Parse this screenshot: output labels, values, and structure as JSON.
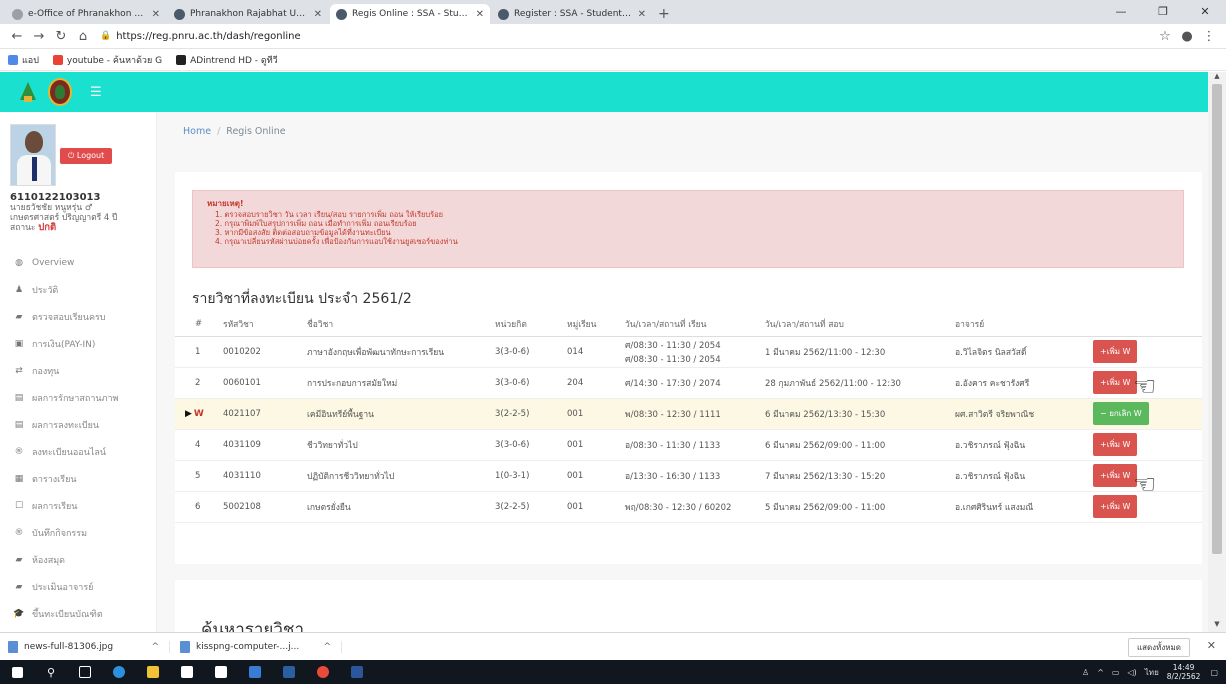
{
  "browser": {
    "tabs": [
      {
        "title": "e-Office of Phranakhon Rajabhat",
        "icon_color": "#9aa0a6"
      },
      {
        "title": "Phranakhon Rajabhat University",
        "icon_color": "#4a5a6a"
      },
      {
        "title": "Regis Online : SSA - Student Sup",
        "icon_color": "#4a5a6a"
      },
      {
        "title": "Register : SSA - Student Support",
        "icon_color": "#4a5a6a"
      }
    ],
    "new_tab": "+",
    "url": "https://reg.pnru.ac.th/dash/regonline",
    "bookmarks": [
      {
        "label": "แอป",
        "icon_color": "#4f8ae8"
      },
      {
        "label": "youtube - ค้นหาด้วย G",
        "icon_color": "#ea4335"
      },
      {
        "label": "ADintrend HD - ดูทีวี",
        "icon_color": "#222222"
      }
    ]
  },
  "sidebar": {
    "logout_label": "Logout",
    "student_id": "6110122103013",
    "student_name": "นายธวัชชัย หนูหรุ่น ♂",
    "program": "เกษตรศาสตร์ ปริญญาตรี 4 ปี",
    "status_label": "สถานะ",
    "status_value": "ปกติ",
    "nav": [
      {
        "label": "Overview",
        "icon": "dashboard-icon",
        "glyph": "◍"
      },
      {
        "label": "ประวัติ",
        "icon": "user-icon",
        "glyph": "♟"
      },
      {
        "label": "ตรวจสอบเรียนครบ",
        "icon": "book-icon",
        "glyph": "▰"
      },
      {
        "label": "การเงิน(PAY-IN)",
        "icon": "money-icon",
        "glyph": "▣"
      },
      {
        "label": "กองทุน",
        "icon": "fund-icon",
        "glyph": "⇄"
      },
      {
        "label": "ผลการรักษาสถานภาพ",
        "icon": "document-icon",
        "glyph": "▤"
      },
      {
        "label": "ผลการลงทะเบียน",
        "icon": "register-icon",
        "glyph": "▤"
      },
      {
        "label": "ลงทะเบียนออนไลน์",
        "icon": "online-icon",
        "glyph": "®"
      },
      {
        "label": "ตารางเรียน",
        "icon": "calendar-icon",
        "glyph": "▦"
      },
      {
        "label": "ผลการเรียน",
        "icon": "grade-icon",
        "glyph": "☐"
      },
      {
        "label": "บันทึกกิจกรรม",
        "icon": "activity-icon",
        "glyph": "®"
      },
      {
        "label": "ห้องสมุด",
        "icon": "library-icon",
        "glyph": "▰"
      },
      {
        "label": "ประเมินอาจารย์",
        "icon": "evaluate-icon",
        "glyph": "▰"
      },
      {
        "label": "ขึ้นทะเบียนบัณฑิต",
        "icon": "graduate-icon",
        "glyph": "🎓"
      }
    ]
  },
  "main": {
    "breadcrumb": {
      "home": "Home",
      "current": "Regis Online"
    },
    "notice": {
      "title": "หมายเหตุ!",
      "lines": [
        "1. ตรวจสอบรายวิชา วัน เวลา เรียน/สอบ รายการเพิ่ม ถอน ให้เรียบร้อย",
        "2. กรุณาพิมพ์ใบสรุปการเพิ่ม ถอน เมื่อทำการเพิ่ม ถอนเรียบร้อย",
        "3. หากมีข้อสงสัย ติดต่อสอบถามข้อมูลได้ที่งานทะเบียน",
        "4. กรุณาเปลี่ยนรหัสผ่านบ่อยครั้ง เพื่อป้องกันการแอบใช้งานยูสเซอร์ของท่าน"
      ]
    },
    "section_title": "รายวิชาที่ลงทะเบียน ประจำ 2561/2",
    "columns": [
      "#",
      "รหัสวิชา",
      "ชื่อวิชา",
      "หน่วยกิต",
      "หมู่เรียน",
      "วัน/เวลา/สถานที่ เรียน",
      "วัน/เวลา/สถานที่ สอบ",
      "อาจารย์"
    ],
    "rows": [
      {
        "no": "1",
        "code": "0010202",
        "name": "ภาษาอังกฤษเพื่อพัฒนาทักษะการเรียน",
        "credit": "3(3-0-6)",
        "section": "014",
        "study1": "ศ/08:30 - 11:30 / 2054",
        "study2": "ศ/08:30 - 11:30 / 2054",
        "exam": "1 มีนาคม 2562/11:00 - 12:30",
        "teacher": "อ.วิไลจิตร นิลสวัสดิ์",
        "action": "+เพิ่ม W"
      },
      {
        "no": "2",
        "code": "0060101",
        "name": "การประกอบการสมัยใหม่",
        "credit": "3(3-0-6)",
        "section": "204",
        "study1": "ศ/14:30 - 17:30 / 2074",
        "study2": "",
        "exam": "28 กุมภาพันธ์ 2562/11:00 - 12:30",
        "teacher": "อ.อังคาร คะชารังศรี",
        "action": "+เพิ่ม W"
      },
      {
        "no": "W",
        "code": "4021107",
        "name": "เคมีอินทรีย์พื้นฐาน",
        "credit": "3(2-2-5)",
        "section": "001",
        "study1": "พ/08:30 - 12:30 / 1111",
        "study2": "",
        "exam": "6 มีนาคม 2562/13:30 - 15:30",
        "teacher": "ผศ.สาวิตรี จริยพาณิช",
        "action": "− ยกเลิก W"
      },
      {
        "no": "4",
        "code": "4031109",
        "name": "ชีววิทยาทั่วไป",
        "credit": "3(3-0-6)",
        "section": "001",
        "study1": "อ/08:30 - 11:30 / 1133",
        "study2": "",
        "exam": "6 มีนาคม 2562/09:00 - 11:00",
        "teacher": "อ.วชิราภรณ์ ฟุ้งฉิน",
        "action": "+เพิ่ม W"
      },
      {
        "no": "5",
        "code": "4031110",
        "name": "ปฏิบัติการชีววิทยาทั่วไป",
        "credit": "1(0-3-1)",
        "section": "001",
        "study1": "อ/13:30 - 16:30 / 1133",
        "study2": "",
        "exam": "7 มีนาคม 2562/13:30 - 15:20",
        "teacher": "อ.วชิราภรณ์ ฟุ้งฉิน",
        "action": "+เพิ่ม W"
      },
      {
        "no": "6",
        "code": "5002108",
        "name": "เกษตรยั่งยืน",
        "credit": "3(2-2-5)",
        "section": "001",
        "study1": "พฤ/08:30 - 12:30 / 60202",
        "study2": "",
        "exam": "5 มีนาคม 2562/09:00 - 11:00",
        "teacher": "อ.เกศศิรินทร์ แสงมณี",
        "action": "+เพิ่ม W"
      }
    ],
    "search_title": "ค้นหารายวิชา"
  },
  "downloads": [
    {
      "name": "news-full-81306.jpg"
    },
    {
      "name": "kisspng-computer-...j..."
    }
  ],
  "downloads_show_all": "แสดงทั้งหมด",
  "clock": {
    "time": "14:49",
    "date": "8/2/2562",
    "lang": "ไทย"
  }
}
